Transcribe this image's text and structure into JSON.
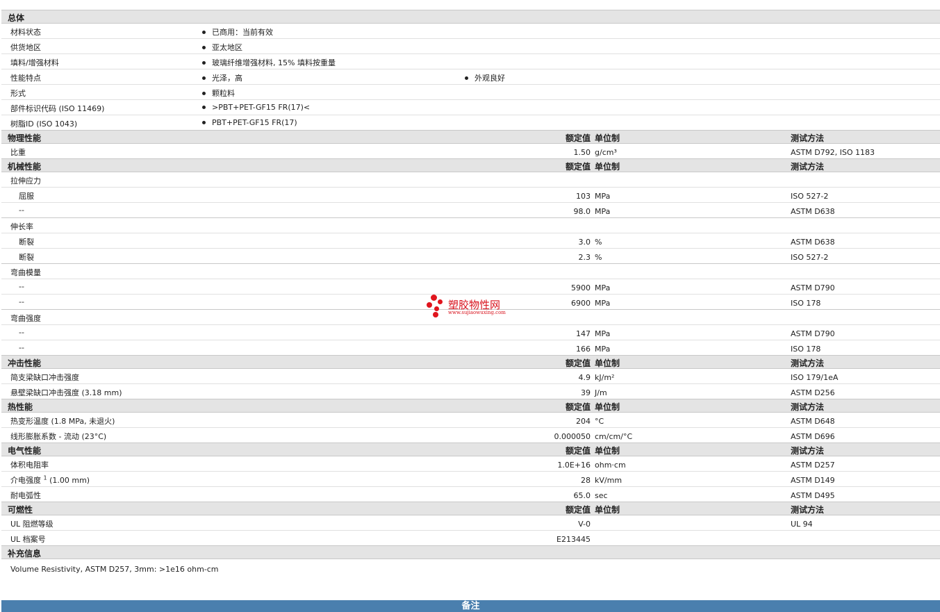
{
  "general": {
    "title": "总体",
    "rows": [
      {
        "name": "材料状态",
        "values": [
          "已商用：当前有效"
        ]
      },
      {
        "name": "供货地区",
        "values": [
          "亚太地区"
        ]
      },
      {
        "name": "填料/增强材料",
        "values": [
          "玻璃纤维增强材料, 15% 填料按重量"
        ]
      },
      {
        "name": "性能特点",
        "values": [
          "光泽，高",
          "外观良好"
        ]
      },
      {
        "name": "形式",
        "values": [
          "颗粒料"
        ]
      },
      {
        "name": "部件标识代码 (ISO 11469)",
        "values": [
          ">PBT+PET-GF15 FR(17)<"
        ]
      },
      {
        "name": "树脂ID (ISO 1043)",
        "values": [
          "PBT+PET-GF15 FR(17)"
        ]
      }
    ]
  },
  "columns": {
    "value": "额定值",
    "unit": "单位制",
    "method": "测试方法"
  },
  "sections": [
    {
      "title": "物理性能",
      "rows": [
        {
          "name": "比重",
          "value": "1.50",
          "unit": "g/cm³",
          "method": "ASTM D792, ISO 1183",
          "sep": true
        }
      ]
    },
    {
      "title": "机械性能",
      "rows": [
        {
          "name": "拉伸应力",
          "value": "",
          "unit": "",
          "method": ""
        },
        {
          "name": "屈服",
          "sub": true,
          "value": "103",
          "unit": "MPa",
          "method": "ISO 527-2"
        },
        {
          "name": "--",
          "sub": true,
          "value": "98.0",
          "unit": "MPa",
          "method": "ASTM D638",
          "sep": true
        },
        {
          "name": "伸长率",
          "value": "",
          "unit": "",
          "method": ""
        },
        {
          "name": "断裂",
          "sub": true,
          "value": "3.0",
          "unit": "%",
          "method": "ASTM D638"
        },
        {
          "name": "断裂",
          "sub": true,
          "value": "2.3",
          "unit": "%",
          "method": "ISO 527-2",
          "sep": true
        },
        {
          "name": "弯曲模量",
          "value": "",
          "unit": "",
          "method": ""
        },
        {
          "name": "--",
          "sub": true,
          "value": "5900",
          "unit": "MPa",
          "method": "ASTM D790"
        },
        {
          "name": "--",
          "sub": true,
          "value": "6900",
          "unit": "MPa",
          "method": "ISO 178",
          "sep": true
        },
        {
          "name": "弯曲强度",
          "value": "",
          "unit": "",
          "method": ""
        },
        {
          "name": "--",
          "sub": true,
          "value": "147",
          "unit": "MPa",
          "method": "ASTM D790"
        },
        {
          "name": "--",
          "sub": true,
          "value": "166",
          "unit": "MPa",
          "method": "ISO 178",
          "sep": true
        }
      ]
    },
    {
      "title": "冲击性能",
      "rows": [
        {
          "name": "简支梁缺口冲击强度",
          "value": "4.9",
          "unit": "kJ/m²",
          "method": "ISO 179/1eA"
        },
        {
          "name": "悬壁梁缺口冲击强度 (3.18 mm)",
          "value": "39",
          "unit": "J/m",
          "method": "ASTM D256",
          "sep": true
        }
      ]
    },
    {
      "title": "热性能",
      "rows": [
        {
          "name": "热变形温度 (1.8 MPa, 未退火)",
          "value": "204",
          "unit": "°C",
          "method": "ASTM D648"
        },
        {
          "name": "线形膨胀系数 - 流动 (23°C)",
          "value": "0.000050",
          "unit": "cm/cm/°C",
          "method": "ASTM D696",
          "sep": true
        }
      ]
    },
    {
      "title": "电气性能",
      "rows": [
        {
          "name": "体积电阻率",
          "value": "1.0E+16",
          "unit": "ohm·cm",
          "method": "ASTM D257"
        },
        {
          "name": "介电强度",
          "sup": "1",
          "extra": " (1.00 mm)",
          "value": "28",
          "unit": "kV/mm",
          "method": "ASTM D149"
        },
        {
          "name": "耐电弧性",
          "value": "65.0",
          "unit": "sec",
          "method": "ASTM D495",
          "sep": true
        }
      ]
    },
    {
      "title": "可燃性",
      "rows": [
        {
          "name": "UL 阻燃等级",
          "value": "V-0",
          "unit": "",
          "method": "UL 94"
        },
        {
          "name": "UL 档案号",
          "value": "E213445",
          "unit": "",
          "method": "",
          "sep": true
        }
      ]
    }
  ],
  "supplement": {
    "title": "补充信息",
    "text": "Volume Resistivity, ASTM D257, 3mm: >1e16 ohm-cm"
  },
  "footer": {
    "title": "备注"
  },
  "watermark": {
    "name": "塑胶物性网",
    "url": "www.sujiaowuxing.com",
    "color": "#e0151e"
  }
}
